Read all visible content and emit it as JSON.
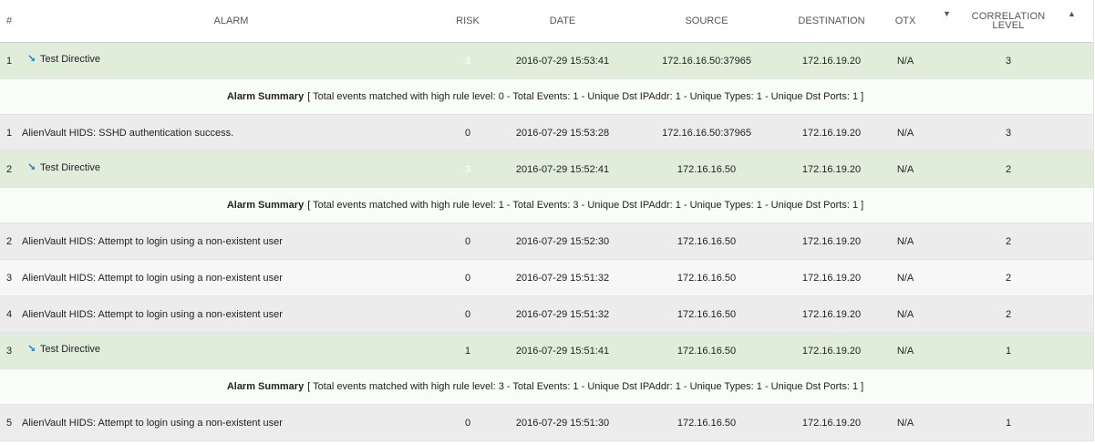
{
  "headers": {
    "num": "#",
    "alarm": "ALARM",
    "risk": "RISK",
    "date": "DATE",
    "source": "SOURCE",
    "destination": "DESTINATION",
    "otx": "OTX",
    "correlation_line1": "CORRELATION",
    "correlation_line2": "LEVEL",
    "sort_desc_arrow": "▼",
    "sort_asc_arrow": "▲"
  },
  "rows": [
    {
      "kind": "directive",
      "num": "1",
      "alarm": "Test Directive",
      "risk": "3",
      "risk_faded": true,
      "date": "2016-07-29 15:53:41",
      "source": "172.16.16.50:37965",
      "destination": "172.16.19.20",
      "otx": "N/A",
      "correlation": "3"
    },
    {
      "kind": "summary",
      "label": "Alarm Summary",
      "text": "[ Total events matched with high rule level: 0 -  Total Events: 1 -  Unique Dst IPAddr: 1 -  Unique Types: 1 -  Unique Dst Ports: 1 ]"
    },
    {
      "kind": "event",
      "num": "1",
      "alarm": "AlienVault HIDS: SSHD authentication success.",
      "risk": "0",
      "date": "2016-07-29 15:53:28",
      "source": "172.16.16.50:37965",
      "destination": "172.16.19.20",
      "otx": "N/A",
      "correlation": "3"
    },
    {
      "kind": "directive",
      "num": "2",
      "alarm": "Test Directive",
      "risk": "3",
      "risk_faded": true,
      "date": "2016-07-29 15:52:41",
      "source": "172.16.16.50",
      "destination": "172.16.19.20",
      "otx": "N/A",
      "correlation": "2"
    },
    {
      "kind": "summary",
      "label": "Alarm Summary",
      "text": "[ Total events matched with high rule level: 1 -  Total Events: 3 -  Unique Dst IPAddr: 1 -  Unique Types: 1 -  Unique Dst Ports: 1 ]"
    },
    {
      "kind": "event",
      "num": "2",
      "alarm": "AlienVault HIDS: Attempt to login using a non-existent user",
      "risk": "0",
      "date": "2016-07-29 15:52:30",
      "source": "172.16.16.50",
      "destination": "172.16.19.20",
      "otx": "N/A",
      "correlation": "2"
    },
    {
      "kind": "event",
      "num": "3",
      "alarm": "AlienVault HIDS: Attempt to login using a non-existent user",
      "risk": "0",
      "date": "2016-07-29 15:51:32",
      "source": "172.16.16.50",
      "destination": "172.16.19.20",
      "otx": "N/A",
      "correlation": "2"
    },
    {
      "kind": "event",
      "num": "4",
      "alarm": "AlienVault HIDS: Attempt to login using a non-existent user",
      "risk": "0",
      "date": "2016-07-29 15:51:32",
      "source": "172.16.16.50",
      "destination": "172.16.19.20",
      "otx": "N/A",
      "correlation": "2"
    },
    {
      "kind": "directive",
      "num": "3",
      "alarm": "Test Directive",
      "risk": "1",
      "risk_faded": false,
      "date": "2016-07-29 15:51:41",
      "source": "172.16.16.50",
      "destination": "172.16.19.20",
      "otx": "N/A",
      "correlation": "1"
    },
    {
      "kind": "summary",
      "label": "Alarm Summary",
      "text": "[ Total events matched with high rule level: 3 -  Total Events: 1 -  Unique Dst IPAddr: 1 -  Unique Types: 1 -  Unique Dst Ports: 1 ]"
    },
    {
      "kind": "event",
      "num": "5",
      "alarm": "AlienVault HIDS: Attempt to login using a non-existent user",
      "risk": "0",
      "date": "2016-07-29 15:51:30",
      "source": "172.16.16.50",
      "destination": "172.16.19.20",
      "otx": "N/A",
      "correlation": "1"
    }
  ],
  "colors": {
    "directive_row": "#e1eddb",
    "summary_row": "#f8fdf7",
    "event_row_dark": "#ececec",
    "event_row_light": "#f7f7f7",
    "directive_icon": "#2a8fd6"
  },
  "icons": {
    "directive": "directive-arrow-icon"
  }
}
